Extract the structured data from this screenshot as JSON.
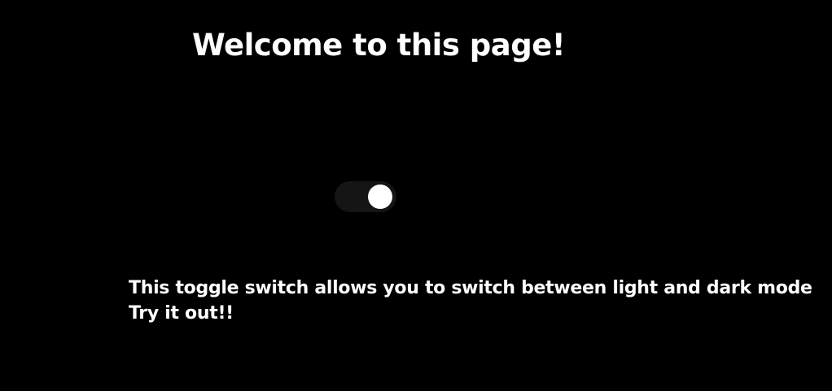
{
  "page": {
    "title": "Welcome to this page!",
    "background_color": "#000000",
    "text_color": "#ffffff"
  },
  "toggle": {
    "state": "on",
    "track_color": "#151515",
    "knob_color": "#ffffff"
  },
  "description": {
    "line1": "This toggle switch allows you to switch between light and dark mode",
    "line2": "Try it out!!"
  }
}
